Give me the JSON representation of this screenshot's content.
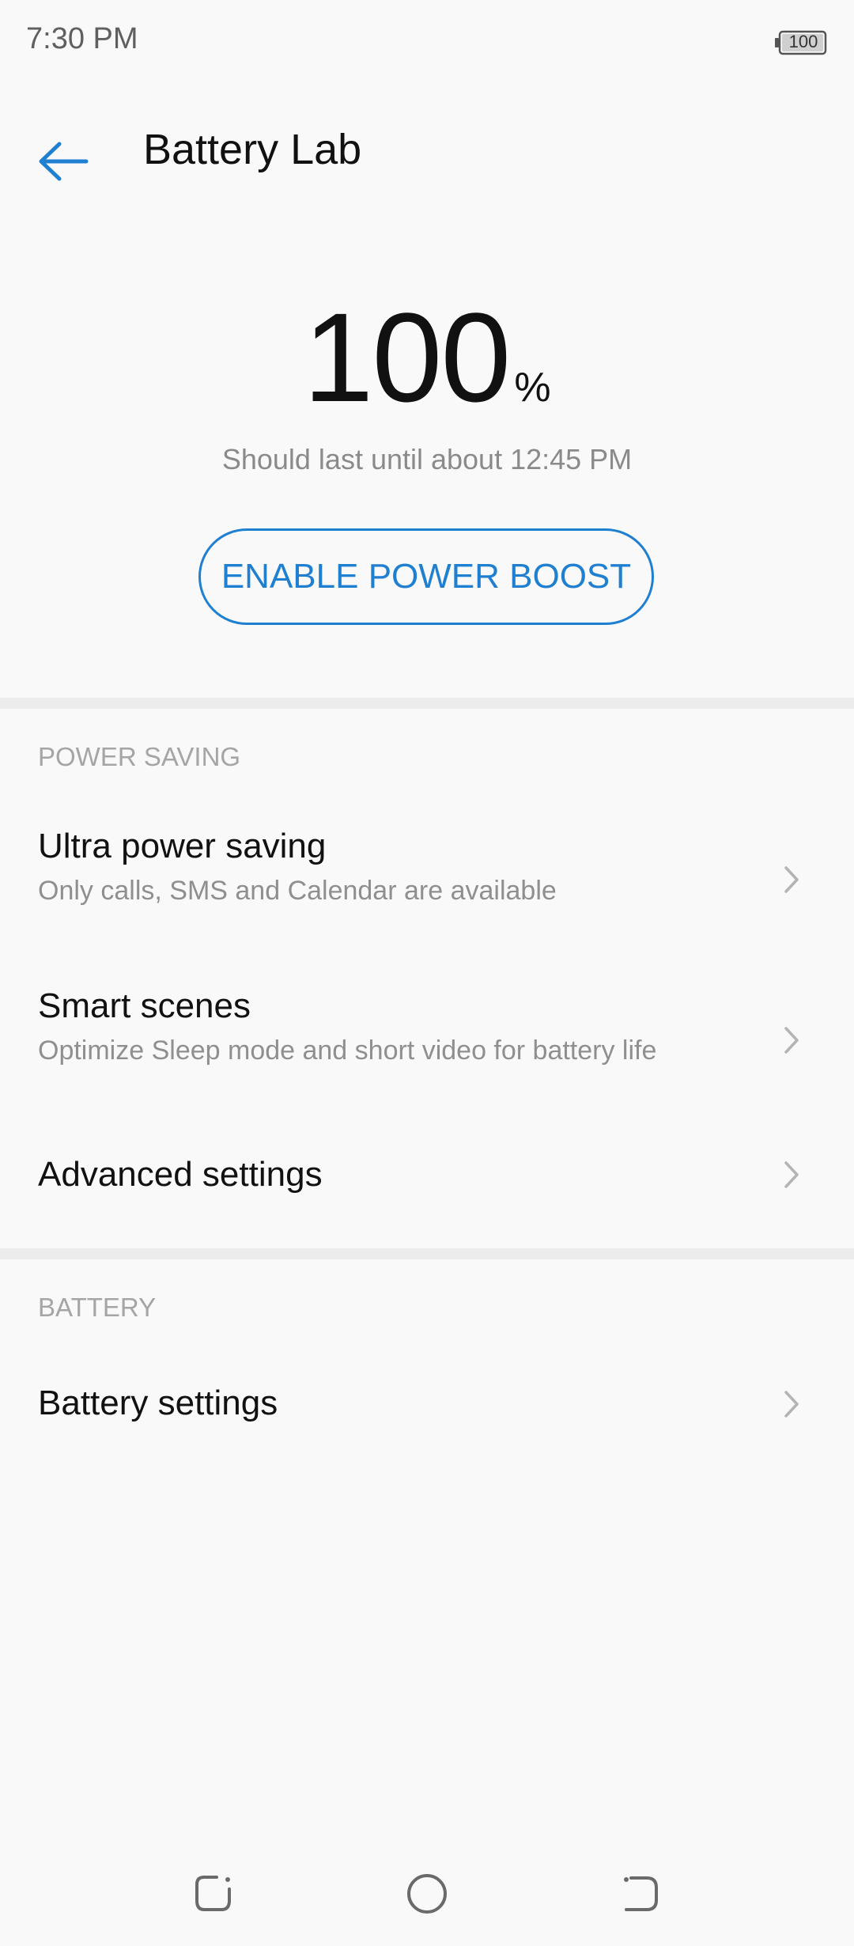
{
  "status_bar": {
    "time": "7:30 PM",
    "battery_level": "100"
  },
  "header": {
    "title": "Battery Lab",
    "back_icon": "arrow-left-icon"
  },
  "battery": {
    "level_value": "100",
    "level_unit": "%",
    "estimate": "Should last until about 12:45 PM"
  },
  "boost_button_label": "ENABLE POWER BOOST",
  "sections": {
    "power_saving": {
      "header": "POWER SAVING",
      "items": [
        {
          "title": "Ultra power saving",
          "subtitle": "Only calls, SMS and Calendar are available"
        },
        {
          "title": "Smart scenes",
          "subtitle": "Optimize Sleep mode and short video for battery life"
        },
        {
          "title": "Advanced settings"
        }
      ]
    },
    "battery": {
      "header": "BATTERY",
      "items": [
        {
          "title": "Battery settings"
        }
      ]
    }
  },
  "colors": {
    "accent": "#1f7fd1",
    "background": "#f9f9f9",
    "divider": "#ececec"
  }
}
